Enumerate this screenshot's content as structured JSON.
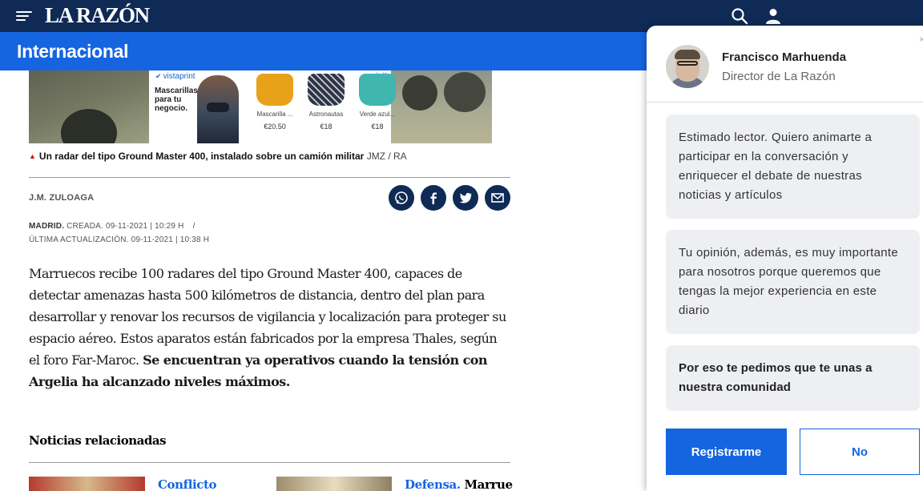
{
  "topbar": {
    "logo": "LA RAZÓN",
    "menu_icon": "hamburger-menu-icon",
    "search_icon": "search-icon",
    "user_icon": "user-icon",
    "bg_color": "#0f2a54"
  },
  "section": {
    "title": "Internacional",
    "bg_color": "#1565e0"
  },
  "ad": {
    "brand": "vistaprint",
    "headline": "Mascarillas para tu negocio.",
    "items": [
      {
        "name": "Mascarilla ...",
        "price": "€20.50"
      },
      {
        "name": "Astronautas",
        "price": "€18"
      },
      {
        "name": "Verde azul...",
        "price": "€18"
      }
    ]
  },
  "photo": {
    "caption": "Un radar del tipo Ground Master 400, instalado sobre un camión militar",
    "credit": "JMZ / RA"
  },
  "article": {
    "author": "J.M. ZULOAGA",
    "share_icons": [
      "whatsapp-icon",
      "facebook-icon",
      "twitter-icon",
      "email-icon"
    ],
    "location": "MADRID.",
    "created": "CREADA. 09-11-2021 | 10:29 H",
    "separator": "/",
    "updated": "ÚLTIMA ACTUALIZACIÓN. 09-11-2021 | 10:38 H",
    "body_plain": "Marruecos recibe 100 radares del tipo Ground Master 400, capaces de detectar amenazas hasta 500 kilómetros de distancia, dentro del plan para desarrollar y renovar los recursos de vigilancia y localización para proteger su espacio aéreo. Estos aparatos están fabricados por la empresa Thales, según el foro Far-Maroc.",
    "body_bold": "Se encuentran ya operativos cuando la tensión con Argelia ha alcanzado niveles máximos."
  },
  "related": {
    "title": "Noticias relacionadas",
    "items": [
      {
        "tag": "Conflicto",
        "rest": ""
      },
      {
        "tag": "Defensa.",
        "rest": "Marrue"
      }
    ]
  },
  "panel": {
    "close": "×",
    "person_name": "Francisco Marhuenda",
    "person_role": "Director de La Razón",
    "messages": [
      "Estimado lector. Quiero animarte a participar en la conversación y enriquecer el debate de nuestras noticias y artículos",
      "Tu opinión, además, es muy importante para nosotros porque queremos que tengas la mejor experiencia en este diario",
      "Por eso te pedimos que te unas a nuestra comunidad"
    ],
    "register_label": "Registrarme",
    "no_label": "No",
    "accent_color": "#1565e0"
  }
}
